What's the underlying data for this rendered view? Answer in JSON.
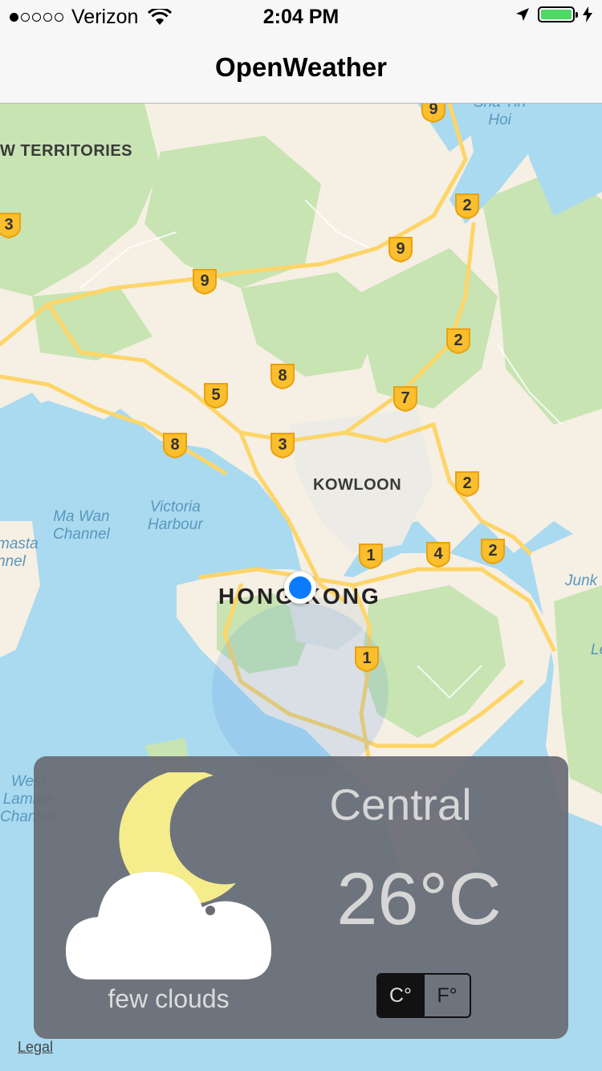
{
  "status_bar": {
    "carrier": "Verizon",
    "time": "2:04 PM",
    "signal_filled": 1,
    "signal_total": 5,
    "battery_level": 1.0
  },
  "nav": {
    "title": "OpenWeather"
  },
  "map": {
    "labels": {
      "territories": "W TERRITORIES",
      "kowloon": "KOWLOON",
      "city": "HONG KONG",
      "sha_tin": "Sha Tin\nHoi",
      "ma_wan": "Ma Wan\nChannel",
      "victoria": "Victoria\nHarbour",
      "masta": "masta\nnnel",
      "west_lamma": "West\nLamma\nChannel",
      "junk": "Junk",
      "le": "Le"
    },
    "route_shields": [
      "9",
      "2",
      "9",
      "9",
      "3",
      "2",
      "8",
      "5",
      "7",
      "8",
      "3",
      "2",
      "1",
      "4",
      "2",
      "1"
    ],
    "legal": "Legal"
  },
  "weather": {
    "icon": "moon-cloud-icon",
    "condition": "few clouds",
    "city": "Central",
    "temperature": "26°C",
    "units": {
      "celsius": "C°",
      "fahrenheit": "F°",
      "selected": "celsius"
    }
  }
}
